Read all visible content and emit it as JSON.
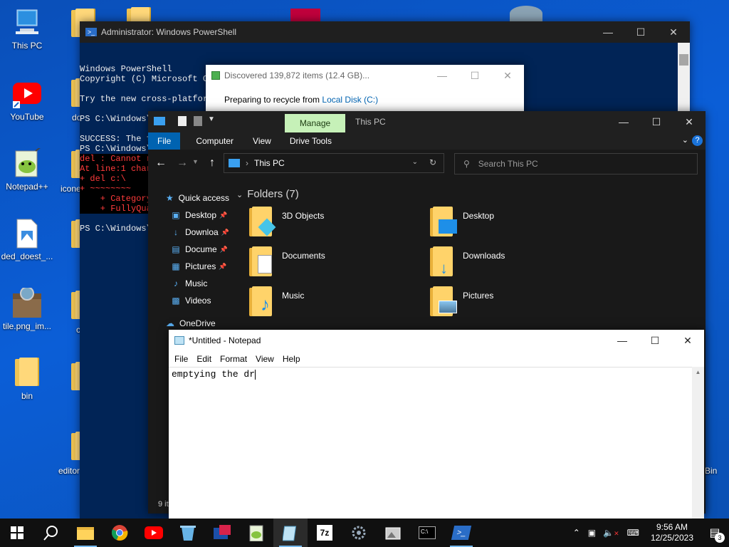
{
  "desktop": {
    "icons": [
      {
        "label": "This PC",
        "icon": "this-pc-icon"
      },
      {
        "label": "YouTube",
        "icon": "youtube-icon"
      },
      {
        "label": "Notepad++",
        "icon": "notepad-plus-plus-icon"
      },
      {
        "label": "ded_doest_...",
        "icon": "image-file-icon"
      },
      {
        "label": "tile.png_im...",
        "icon": "archive-icon"
      },
      {
        "label": "bin",
        "icon": "folder-icon"
      }
    ],
    "partial_labels": {
      "youtube_neighbor": "dc",
      "notepad_neighbor": "icone",
      "tile_neighbor": "c",
      "editor": "editor",
      "right_bin": "Bin"
    }
  },
  "powershell": {
    "title": "Administrator: Windows PowerShell",
    "lines": [
      {
        "text": "Windows PowerShell",
        "err": false
      },
      {
        "text": "Copyright (C) Microsoft Corporation. All rights reserved.",
        "err": false
      },
      {
        "text": "",
        "err": false
      },
      {
        "text": "Try the new cross-platfor",
        "err": false
      },
      {
        "text": "",
        "err": false
      },
      {
        "text": "PS C:\\Windows\\system32> t",
        "err": false
      },
      {
        "text": "",
        "err": false
      },
      {
        "text": "SUCCESS: The f",
        "err": false
      },
      {
        "text": "PS C:\\Windows\\",
        "err": false
      },
      {
        "text": "del : Cannot r",
        "err": true
      },
      {
        "text": "At line:1 char",
        "err": true
      },
      {
        "text": "+ del c:\\",
        "err": true
      },
      {
        "text": "+ ~~~~~~~~",
        "err": true
      },
      {
        "text": "    + Category",
        "err": true
      },
      {
        "text": "    + FullyQua",
        "err": true
      },
      {
        "text": "",
        "err": false
      },
      {
        "text": "PS C:\\Windows\\",
        "err": false
      }
    ]
  },
  "recycle_dialog": {
    "title": "Discovered 139,872 items (12.4 GB)...",
    "message_prefix": "Preparing to recycle from ",
    "message_link": "Local Disk (C:)"
  },
  "explorer": {
    "manage_tab": "Manage",
    "title": "This PC",
    "ribbon_tabs": [
      "File",
      "Computer",
      "View",
      "Drive Tools"
    ],
    "address": "This PC",
    "search_placeholder": "Search This PC",
    "nav_items": [
      {
        "label": "Quick access",
        "icon": "star-icon",
        "pinned": false
      },
      {
        "label": "Desktop",
        "icon": "desktop-icon",
        "pinned": true
      },
      {
        "label": "Downloa",
        "icon": "download-icon",
        "pinned": true
      },
      {
        "label": "Docume",
        "icon": "document-icon",
        "pinned": true
      },
      {
        "label": "Pictures",
        "icon": "pictures-icon",
        "pinned": true
      },
      {
        "label": "Music",
        "icon": "music-icon",
        "pinned": false
      },
      {
        "label": "Videos",
        "icon": "videos-icon",
        "pinned": false
      },
      {
        "label": "OneDrive",
        "icon": "cloud-icon",
        "pinned": false
      }
    ],
    "section_title": "Folders (7)",
    "folders": [
      {
        "name": "3D Objects",
        "icon": "3d-objects-folder-icon"
      },
      {
        "name": "Desktop",
        "icon": "desktop-folder-icon"
      },
      {
        "name": "Documents",
        "icon": "documents-folder-icon"
      },
      {
        "name": "Downloads",
        "icon": "downloads-folder-icon"
      },
      {
        "name": "Music",
        "icon": "music-folder-icon"
      },
      {
        "name": "Pictures",
        "icon": "pictures-folder-icon"
      }
    ],
    "status_partial": "9 it"
  },
  "notepad": {
    "title": "*Untitled - Notepad",
    "menu": [
      "File",
      "Edit",
      "Format",
      "View",
      "Help"
    ],
    "content": "emptying the dr"
  },
  "taskbar": {
    "apps": [
      "start-icon",
      "search-icon",
      "file-explorer-icon",
      "chrome-icon",
      "youtube-icon",
      "recycle-icon",
      "app-icon",
      "notepad-plus-plus-icon",
      "notepad-icon",
      "7zip-icon",
      "settings-icon",
      "image-viewer-icon",
      "terminal-icon",
      "powershell-icon"
    ],
    "time": "9:56 AM",
    "date": "12/25/2023",
    "notification_count": "3"
  },
  "colors": {
    "desktop_bg": "#0b5ed7",
    "ps_bg": "#012456",
    "ps_error": "#ff3b3b",
    "explorer_bg": "#191919",
    "manage_tab": "#c6f1b8",
    "file_tab": "#0063b1",
    "taskbar_bg": "#101010"
  }
}
